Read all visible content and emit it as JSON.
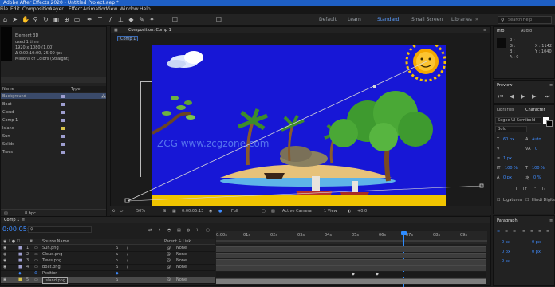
{
  "app": {
    "title": "Adobe After Effects 2020 - Untitled Project.aep *"
  },
  "menu": [
    "File",
    "Edit",
    "Composition",
    "Layer",
    "Effect",
    "Animation",
    "View",
    "Window",
    "Help"
  ],
  "workspace": {
    "tabs": [
      "Default",
      "Learn",
      "Standard",
      "Small Screen",
      "Libraries"
    ],
    "active": "Standard",
    "search_placeholder": "Search Help"
  },
  "project_panel": {
    "name_header": "Name",
    "type_header": "Type",
    "info_lines": [
      "Element 3D",
      "used 1 time",
      "1920 x 1080 (1.00)",
      "Δ 0:00:10:00, 25.00 fps",
      "Millions of Colors (Straight)"
    ],
    "items": [
      {
        "name": "Background",
        "color": "#9e9ecf"
      },
      {
        "name": "Boat",
        "color": "#9e9ecf"
      },
      {
        "name": "Cloud",
        "color": "#9e9ecf"
      },
      {
        "name": "Comp 1",
        "color": "#9e9ecf"
      },
      {
        "name": "Island",
        "color": "#d7c34a"
      },
      {
        "name": "Sun",
        "color": "#9e9ecf"
      },
      {
        "name": "Solids",
        "color": "#9e9ecf"
      },
      {
        "name": "Trees",
        "color": "#9e9ecf"
      }
    ],
    "bit_depth": "8 bpc"
  },
  "composition_panel": {
    "tab_label": "Composition: Comp 1",
    "flow_label": "Comp 1",
    "zoom": "50%",
    "timecode": "0:00:05:13",
    "resolution": "Full",
    "camera": "Active Camera",
    "views": "1 View",
    "watermark": "ZCG www.zcgzone.com"
  },
  "info_panel": {
    "tab": "Info",
    "audio_tab": "Audio",
    "lines": [
      "R :",
      "G :",
      "B :",
      "A : 0",
      "X : 1142",
      "Y : 1040"
    ]
  },
  "preview_panel": {
    "tab": "Preview"
  },
  "character_panel": {
    "tab": "Character",
    "font": "Segoe UI Semibold",
    "style": "Bold",
    "size": "60 px",
    "leading": "Auto",
    "tracking": "0",
    "stroke": "1 px",
    "vert_scale": "100 %",
    "horiz_scale": "100 %",
    "baseline": "0 px",
    "tsume": "0 %",
    "ligatures": "Ligatures",
    "hindi": "Hindi Digits"
  },
  "paragraph_panel": {
    "tab": "Paragraph",
    "values": [
      "0 px",
      "0 px",
      "0 px",
      "0 px",
      "0 px"
    ]
  },
  "timeline_panel": {
    "tab": "Comp 1",
    "current_time": "0:00:05:13",
    "layer_name_header": "Source Name",
    "parent_header": "Parent & Link",
    "ruler_labels": [
      "0:00s",
      "01s",
      "02s",
      "03s",
      "04s",
      "05s",
      "06s",
      "07s",
      "08s",
      "09s"
    ],
    "playhead_fraction": 0.69,
    "layers": [
      {
        "num": "1",
        "name": "Sun.png",
        "parent": "None"
      },
      {
        "num": "2",
        "name": "Cloud.png",
        "parent": "None"
      },
      {
        "num": "3",
        "name": "Trees.png",
        "parent": "None"
      },
      {
        "num": "4",
        "name": "Boat.png",
        "parent": "None"
      },
      {
        "num": "",
        "name": "Position",
        "parent": ""
      },
      {
        "num": "5",
        "name": "Island.png",
        "parent": "None"
      }
    ]
  },
  "colors": {
    "accent": "#2d8cff",
    "title_bar": "#1e5fc4",
    "canvas": "#1717d6",
    "sand_strip": "#f0c400"
  }
}
